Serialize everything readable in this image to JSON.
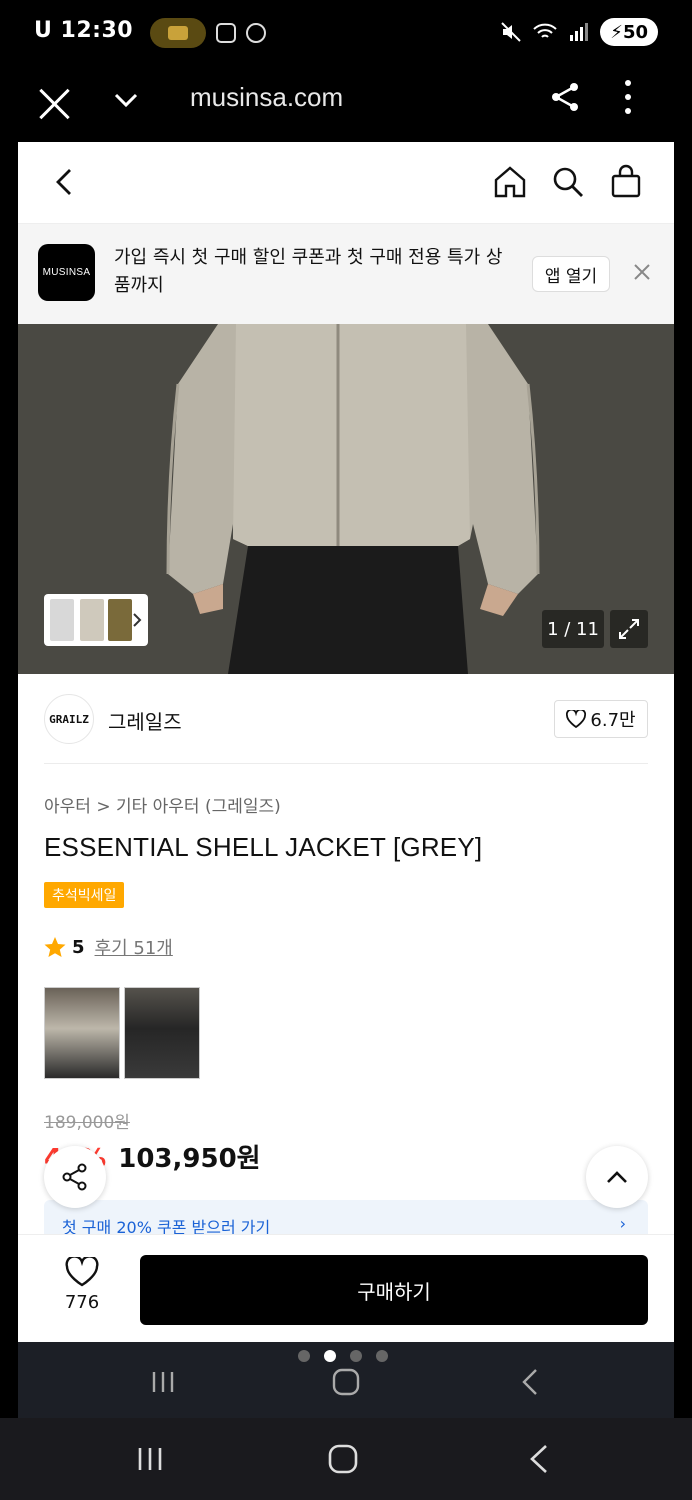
{
  "status_bar": {
    "time": "12:30",
    "left_mark": "U",
    "battery": "50"
  },
  "browser": {
    "url": "musinsa.com"
  },
  "app_banner": {
    "logo_text": "MUSINSA",
    "message": "가입 즉시 첫 구매 할인 쿠폰과 첫 구매 전용 특가 상품까지",
    "open_app_label": "앱 열기"
  },
  "gallery": {
    "counter": "1 / 11"
  },
  "brand": {
    "logo_text": "GRAILZ",
    "name": "그레일즈",
    "likes": "6.7만"
  },
  "product": {
    "breadcrumb": "아우터 > 기타 아우터 (그레일즈)",
    "title": "ESSENTIAL SHELL JACKET [GREY]",
    "sale_badge": "추석빅세일",
    "rating": "5",
    "reviews": "후기 51개",
    "original_price": "189,000원",
    "discount": "45%",
    "price": "103,950원",
    "coupon_text": "첫 구매 20% 쿠폰 받으러 가기"
  },
  "bottom_bar": {
    "wish_count": "776",
    "buy_label": "구매하기"
  },
  "colors": {
    "accent_sale": "#ffa800",
    "discount_red": "#ff3b30",
    "coupon_blue": "#1a62d6"
  }
}
